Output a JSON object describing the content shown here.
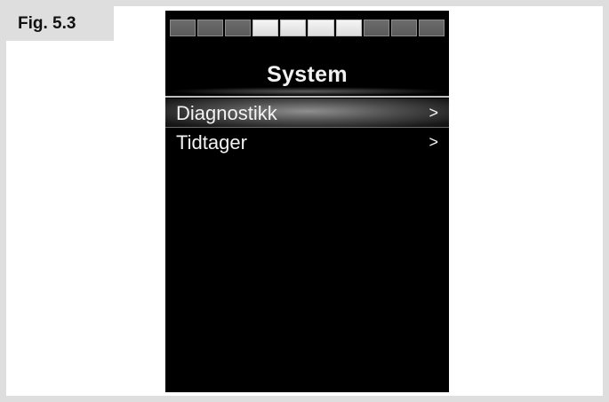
{
  "figure": {
    "label": "Fig. 5.3"
  },
  "device": {
    "battery": {
      "segments_total": 10,
      "segments_lit": [
        4,
        5,
        6,
        7
      ]
    },
    "title": "System",
    "menu": [
      {
        "label": "Diagnostikk",
        "chevron": ">",
        "selected": true
      },
      {
        "label": "Tidtager",
        "chevron": ">",
        "selected": false
      }
    ]
  }
}
